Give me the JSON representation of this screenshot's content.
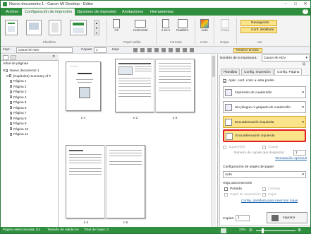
{
  "titlebar": {
    "title": "Nuevo documento 1 - Canon iW Desktop - Editor",
    "minimize": "–",
    "maximize": "□",
    "close": "✕"
  },
  "ribbon_tabs": [
    "Archivo",
    "Configuración de impresión",
    "Opciones de impresión",
    "Anotaciones",
    "Herramientas"
  ],
  "ribbon": {
    "groups": [
      "Plantillas",
      "Papel salida",
      "Formato",
      "Color",
      "Grapa",
      "Ver"
    ],
    "orientation_label": "Horizontal",
    "paper_label": "A4",
    "pages_label": "1 en 1",
    "custom_label": "Cuadern.",
    "color_label": "Auto",
    "staple_label": "Grapa",
    "view_nav": "Navegación",
    "view_detail": "Conf. detallada"
  },
  "toolbar2": {
    "printer_label": "Impr:",
    "printer_value": "Canon iR-ADV",
    "copies_label": "Copias:",
    "copies_value": "1",
    "print_label": "Impr.",
    "show_annot_label": "Mostrar anotac."
  },
  "leftpanel": {
    "tree_title": "Árbol de páginas",
    "items": [
      {
        "label": "Nuevo documento 1",
        "level": 0
      },
      {
        "label": "(Capítulo2) Summary of F",
        "level": 1
      },
      {
        "label": "Página 1",
        "level": 2
      },
      {
        "label": "Página 2",
        "level": 2
      },
      {
        "label": "Página 3",
        "level": 2
      },
      {
        "label": "Página 4",
        "level": 2
      },
      {
        "label": "Página 5",
        "level": 2
      },
      {
        "label": "Página 6",
        "level": 2
      },
      {
        "label": "Página 7",
        "level": 2
      },
      {
        "label": "Página 8",
        "level": 2
      },
      {
        "label": "Página 9",
        "level": 2
      },
      {
        "label": "Página 10",
        "level": 2
      },
      {
        "label": "Página 11",
        "level": 2
      }
    ]
  },
  "main": {
    "pages": [
      "1-1",
      "1-2",
      "1-3",
      "1-4",
      "1-5"
    ]
  },
  "rightpanel": {
    "printer_name_label": "Nombre de la impresora:",
    "printer_name_value": "Canon iR-ADV",
    "tabs": [
      "Plantillas",
      "Config. Impresión",
      "Config. Página"
    ],
    "apply_label": "Aplic. conf. color a vista prelim.",
    "booklet_label": "Impresión de cuadernillo",
    "nofold_label": "Sin pliegue ni grapado de cuadernillo",
    "binding_label": "Encuadernación izquierda",
    "binding_item_label": "Encuadernación izquierda",
    "squarefold_label": "Squarefold",
    "staple_label": "Grapar",
    "copies_shift_label": "Número de copias que desplazar:",
    "copies_shift_value": "1",
    "trim_link": "Terminación opcional",
    "paper_source_label": "Configuración de origen del papel",
    "paper_source_value": "Auto",
    "insert_label": "Hoja para inserción",
    "cover_label": "Portada",
    "back_cover_label": "Contrap.",
    "separator_label": "Papel de separación",
    "sheets_label": "Hojas",
    "detail_link": "Config. detallada para inserción hojas",
    "copies_label": "Copias:",
    "copies_value": "1",
    "print_button": "Imprimir"
  },
  "statusbar": {
    "selected_label": "Página seleccionada: /11",
    "size_label": "Tamaño de salida:A4",
    "total_label": "Total de hojas: 3",
    "zoom_value": "23%"
  }
}
